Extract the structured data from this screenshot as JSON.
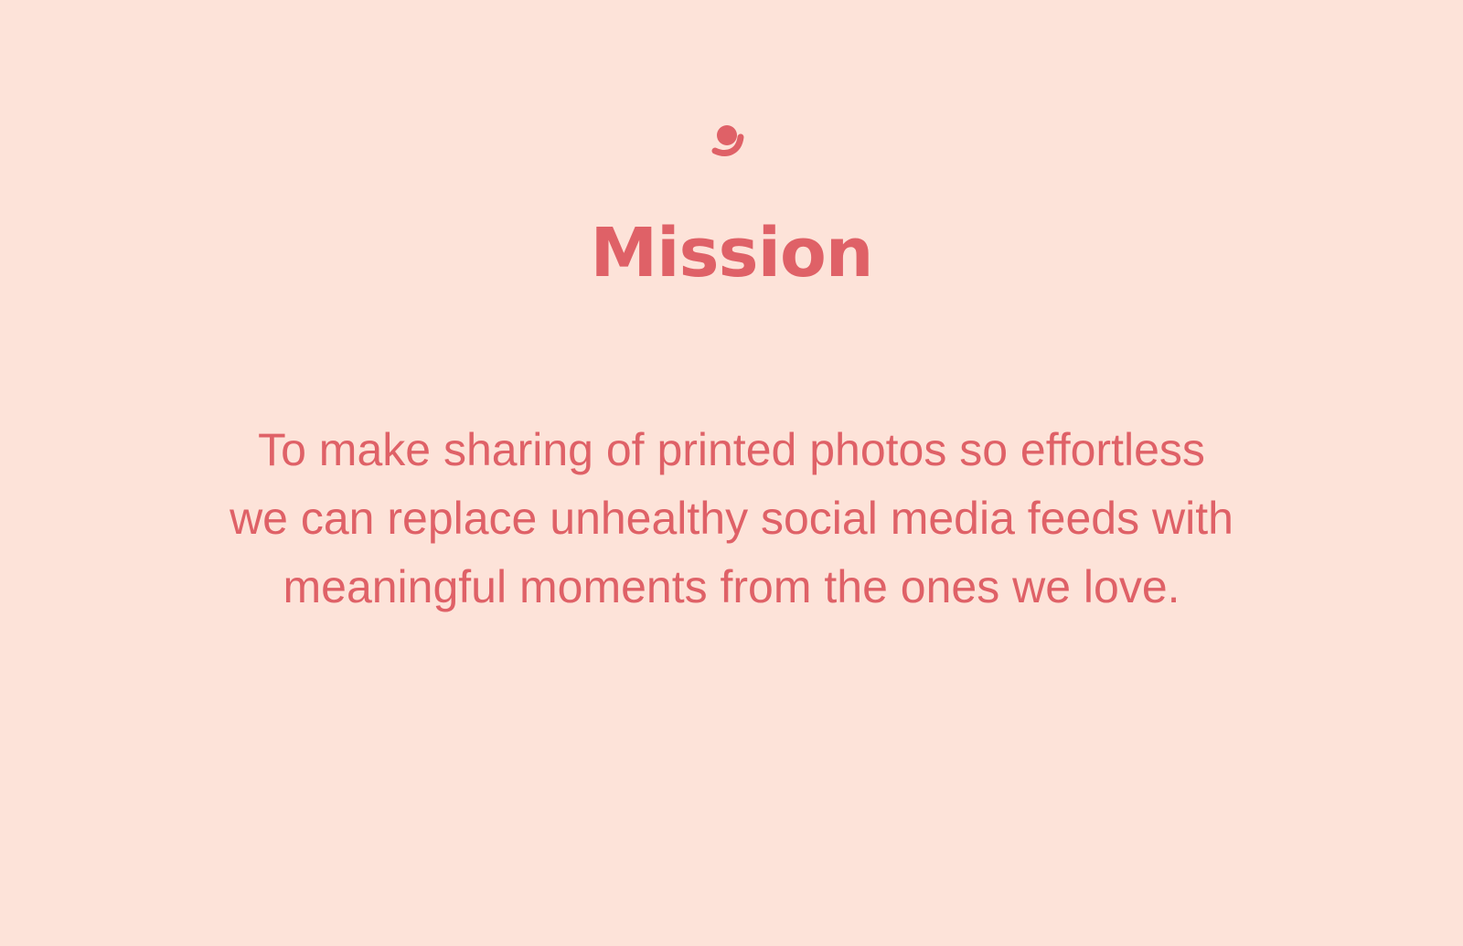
{
  "logo": {
    "icon": "smiling-person-icon",
    "color": "#df6167"
  },
  "title": "Mission",
  "mission": {
    "lines": [
      "To make sharing of printed photos so effortless",
      "we can replace unhealthy social media feeds with",
      "meaningful moments from the ones we love."
    ]
  },
  "colors": {
    "background": "#fde3d9",
    "accent": "#df6167"
  }
}
